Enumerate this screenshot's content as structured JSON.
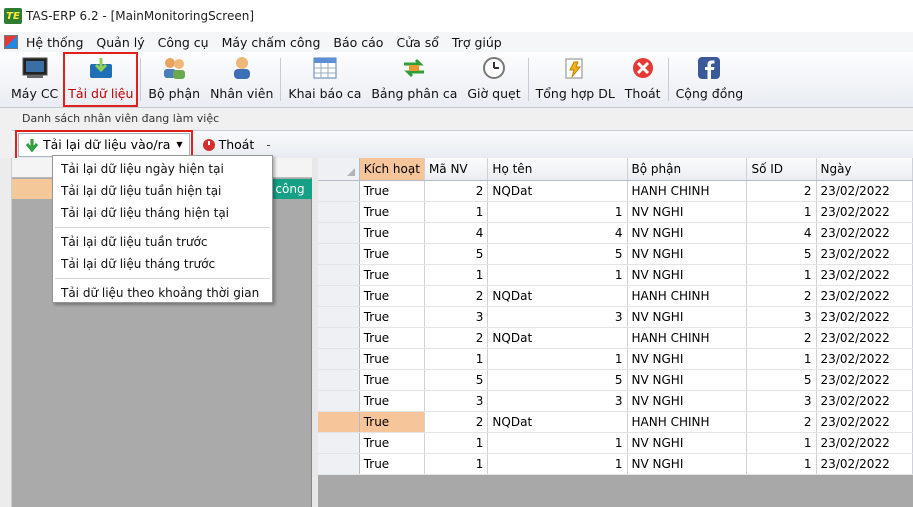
{
  "window": {
    "title": "TAS-ERP 6.2 - [MainMonitoringScreen]",
    "logo_text": "TE"
  },
  "menu": [
    "Hệ thống",
    "Quản lý",
    "Công cụ",
    "Máy chấm công",
    "Báo cáo",
    "Cửa sổ",
    "Trợ giúp"
  ],
  "toolbar": {
    "may_cc": "Máy CC",
    "tai_du_lieu": "Tải dữ liệu",
    "bo_phan": "Bộ phận",
    "nhan_vien": "Nhân viên",
    "khai_bao_ca": "Khai báo ca",
    "bang_phan_ca": "Bảng phân ca",
    "gio_quet": "Giờ quẹt",
    "tong_hop_dl": "Tổng hợp DL",
    "thoat": "Thoát",
    "cong_dong": "Cộng đồng"
  },
  "panel": {
    "caption": "Danh sách nhân viên đang làm việc"
  },
  "sub_toolbar": {
    "reload_label": "Tải lại dữ liệu vào/ra",
    "exit_label": "Thoát",
    "dash": "-"
  },
  "left": {
    "teal_text": "n công"
  },
  "dropdown": {
    "group1": [
      "Tải lại dữ liệu ngày hiện tại",
      "Tải lại dữ liệu tuần hiện tại",
      "Tải lại dữ liệu tháng hiện tại"
    ],
    "group2": [
      "Tải lại dữ liệu tuần trước",
      "Tải lại dữ liệu tháng trước"
    ],
    "group3": [
      "Tải dữ liệu theo khoảng thời gian"
    ]
  },
  "grid": {
    "columns": [
      "Kích hoạt",
      "Mã NV",
      "Họ tên",
      "Bộ phận",
      "Số ID",
      "Ngày"
    ],
    "rows": [
      [
        "True",
        "2",
        "NQDat",
        "HANH CHINH",
        "2",
        "23/02/2022"
      ],
      [
        "True",
        "1",
        "1",
        "NV NGHI",
        "1",
        "23/02/2022"
      ],
      [
        "True",
        "4",
        "4",
        "NV NGHI",
        "4",
        "23/02/2022"
      ],
      [
        "True",
        "5",
        "5",
        "NV NGHI",
        "5",
        "23/02/2022"
      ],
      [
        "True",
        "1",
        "1",
        "NV NGHI",
        "1",
        "23/02/2022"
      ],
      [
        "True",
        "2",
        "NQDat",
        "HANH CHINH",
        "2",
        "23/02/2022"
      ],
      [
        "True",
        "3",
        "3",
        "NV NGHI",
        "3",
        "23/02/2022"
      ],
      [
        "True",
        "2",
        "NQDat",
        "HANH CHINH",
        "2",
        "23/02/2022"
      ],
      [
        "True",
        "1",
        "1",
        "NV NGHI",
        "1",
        "23/02/2022"
      ],
      [
        "True",
        "5",
        "5",
        "NV NGHI",
        "5",
        "23/02/2022"
      ],
      [
        "True",
        "3",
        "3",
        "NV NGHI",
        "3",
        "23/02/2022"
      ],
      [
        "True",
        "2",
        "NQDat",
        "HANH CHINH",
        "2",
        "23/02/2022"
      ],
      [
        "True",
        "1",
        "1",
        "NV NGHI",
        "1",
        "23/02/2022"
      ],
      [
        "True",
        "1",
        "1",
        "NV NGHI",
        "1",
        "23/02/2022"
      ]
    ],
    "selected_row_index": 11
  },
  "colors": {
    "highlight_red": "#e0201b",
    "selected_row": "#f7c59a",
    "teal": "#16a085"
  }
}
